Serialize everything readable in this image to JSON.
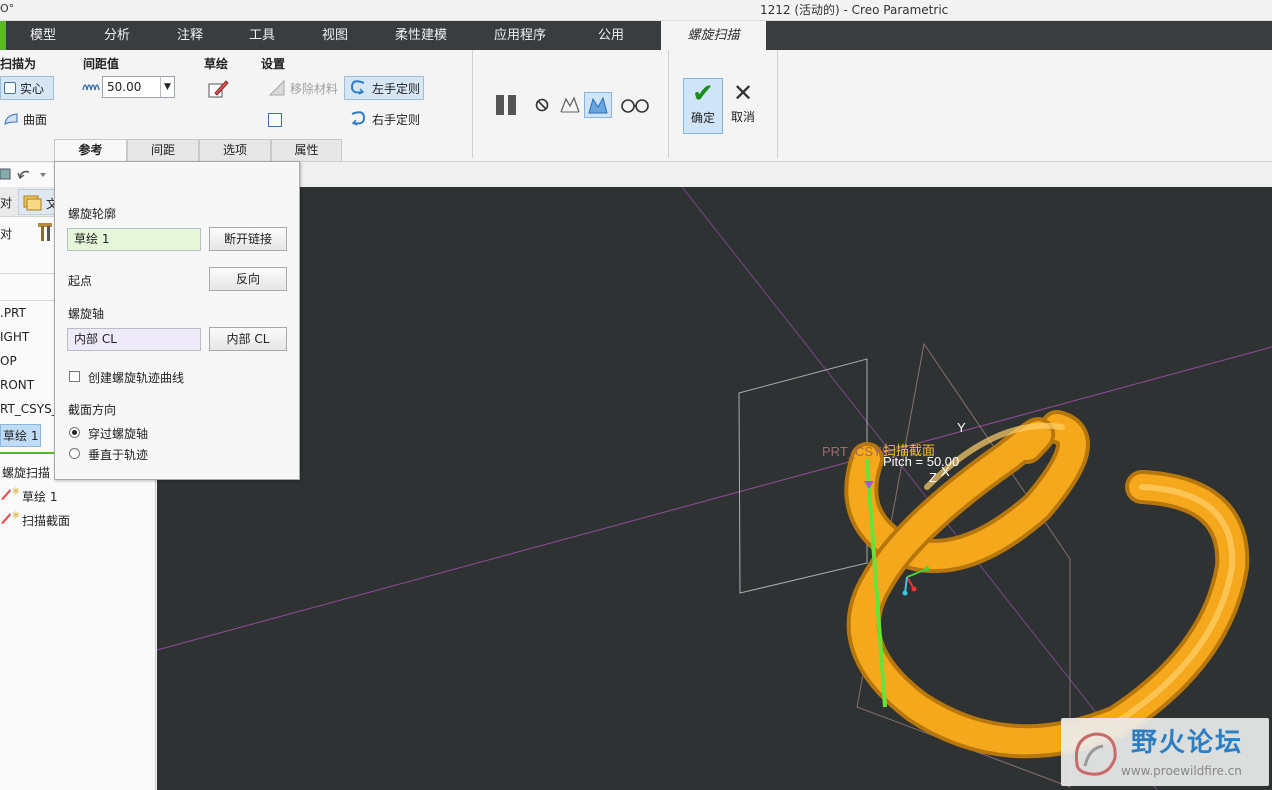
{
  "window": {
    "logo": "O°",
    "title": "1212 (活动的) - Creo Parametric"
  },
  "ribbon_tabs": [
    "模型",
    "分析",
    "注释",
    "工具",
    "视图",
    "柔性建模",
    "应用程序",
    "公用",
    "螺旋扫描"
  ],
  "ribbon": {
    "sweep_as": {
      "label": "扫描为",
      "solid": "实心",
      "surface": "曲面"
    },
    "pitch": {
      "label": "间距值",
      "value": "50.00"
    },
    "sketch": {
      "label": "草绘"
    },
    "settings": {
      "label": "设置",
      "remove_material": "移除材料",
      "left_handed": "左手定则",
      "right_handed": "右手定则"
    },
    "confirm": "确定",
    "cancel": "取消"
  },
  "dashboard_tabs": [
    "参考",
    "间距",
    "选项",
    "属性"
  ],
  "references_panel": {
    "profile_label": "螺旋轮廓",
    "profile_value": "草绘 1",
    "unlink_button": "断开链接",
    "start_label": "起点",
    "flip_button": "反向",
    "axis_label": "螺旋轴",
    "axis_value": "内部 CL",
    "axis_button": "内部 CL",
    "create_curve": "创建螺旋轨迹曲线",
    "section_orient_label": "截面方向",
    "through_axis": "穿过螺旋轴",
    "normal_to_traj": "垂直于轨迹"
  },
  "left_panel": {
    "row1": "对",
    "row1b": "文",
    "row2": "对",
    "items": [
      ".PRT",
      "IGHT",
      "OP",
      "RONT",
      "RT_CSYS_",
      "草绘 1"
    ],
    "feature": "螺旋扫描",
    "sub_items": [
      "草绘 1",
      "扫描截面"
    ]
  },
  "viewport": {
    "csys_label": "PRT_CSYS",
    "section_label": "扫描截面",
    "pitch_label": "Pitch = 50.00",
    "axis_y": "Y",
    "axis_x": "X",
    "axis_z": "Z"
  },
  "watermark": {
    "title": "野火论坛",
    "url": "www.proewildfire.cn"
  },
  "colors": {
    "accent": "#5cb82a",
    "spring": "#f5a81c",
    "viewport_bg": "#2f3233"
  }
}
